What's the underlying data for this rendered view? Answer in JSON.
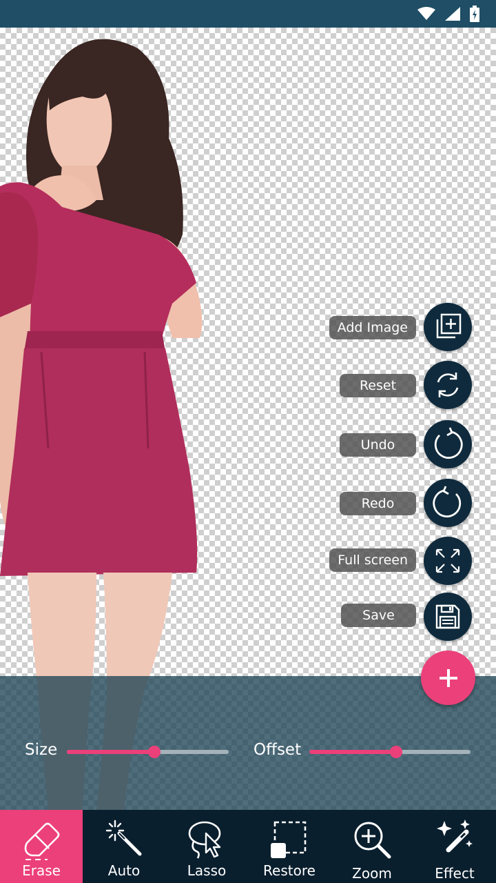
{
  "colors": {
    "status_bar": "#1f4e66",
    "accent": "#ec407a",
    "fab": "#0f2a3c",
    "toolbar": "#0a1f2e",
    "label_bg": "#545454"
  },
  "status_bar": {
    "icons": [
      "wifi-icon",
      "signal-icon",
      "battery-charging-icon"
    ]
  },
  "sliders": {
    "size": {
      "label": "Size",
      "value": 0.54
    },
    "offset": {
      "label": "Offset",
      "value": 0.54
    }
  },
  "fab_menu": [
    {
      "label": "Add Image",
      "icon": "add-image-icon"
    },
    {
      "label": "Reset",
      "icon": "reset-icon"
    },
    {
      "label": "Undo",
      "icon": "undo-icon"
    },
    {
      "label": "Redo",
      "icon": "redo-icon"
    },
    {
      "label": "Full screen",
      "icon": "fullscreen-icon"
    },
    {
      "label": "Save",
      "icon": "save-icon"
    }
  ],
  "fab_main": {
    "icon": "plus-icon"
  },
  "toolbar": [
    {
      "label": "Erase",
      "icon": "eraser-icon",
      "active": true
    },
    {
      "label": "Auto",
      "icon": "magic-wand-icon",
      "active": false
    },
    {
      "label": "Lasso",
      "icon": "lasso-icon",
      "active": false
    },
    {
      "label": "Restore",
      "icon": "restore-icon",
      "active": false
    },
    {
      "label": "Zoom",
      "icon": "zoom-icon",
      "active": false
    },
    {
      "label": "Effect",
      "icon": "effect-icon",
      "active": false
    }
  ]
}
